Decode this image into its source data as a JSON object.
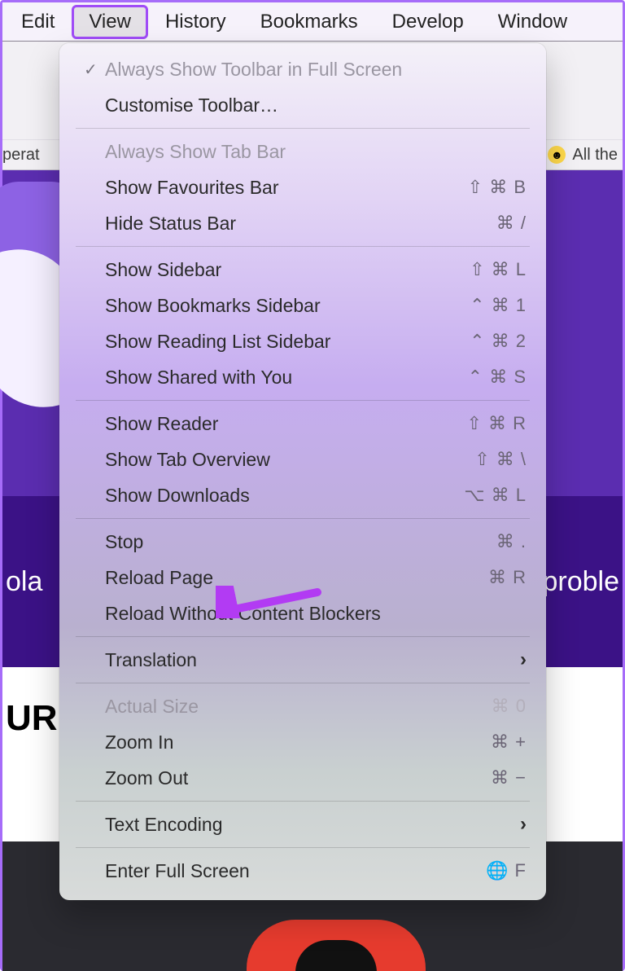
{
  "menubar": {
    "items": [
      "Edit",
      "View",
      "History",
      "Bookmarks",
      "Develop",
      "Window"
    ],
    "highlighted_index": 1
  },
  "bookmarks_bar": {
    "left_fragment": "perat",
    "right_label": "All the"
  },
  "page_fragments": {
    "band_left": "ola",
    "band_right": "proble",
    "headline_fragment": "UR"
  },
  "dropdown": {
    "groups": [
      [
        {
          "label": "Always Show Toolbar in Full Screen",
          "shortcut": "",
          "disabled": true,
          "checked": true,
          "submenu": false
        },
        {
          "label": "Customise Toolbar…",
          "shortcut": "",
          "disabled": false,
          "checked": false,
          "submenu": false
        }
      ],
      [
        {
          "label": "Always Show Tab Bar",
          "shortcut": "",
          "disabled": true,
          "checked": false,
          "submenu": false
        },
        {
          "label": "Show Favourites Bar",
          "shortcut": "⇧ ⌘ B",
          "disabled": false,
          "checked": false,
          "submenu": false
        },
        {
          "label": "Hide Status Bar",
          "shortcut": "⌘ /",
          "disabled": false,
          "checked": false,
          "submenu": false
        }
      ],
      [
        {
          "label": "Show Sidebar",
          "shortcut": "⇧ ⌘ L",
          "disabled": false,
          "checked": false,
          "submenu": false
        },
        {
          "label": "Show Bookmarks Sidebar",
          "shortcut": "⌃ ⌘ 1",
          "disabled": false,
          "checked": false,
          "submenu": false
        },
        {
          "label": "Show Reading List Sidebar",
          "shortcut": "⌃ ⌘ 2",
          "disabled": false,
          "checked": false,
          "submenu": false
        },
        {
          "label": "Show Shared with You",
          "shortcut": "⌃ ⌘ S",
          "disabled": false,
          "checked": false,
          "submenu": false
        }
      ],
      [
        {
          "label": "Show Reader",
          "shortcut": "⇧ ⌘ R",
          "disabled": false,
          "checked": false,
          "submenu": false
        },
        {
          "label": "Show Tab Overview",
          "shortcut": "⇧ ⌘ \\",
          "disabled": false,
          "checked": false,
          "submenu": false
        },
        {
          "label": "Show Downloads",
          "shortcut": "⌥ ⌘ L",
          "disabled": false,
          "checked": false,
          "submenu": false
        }
      ],
      [
        {
          "label": "Stop",
          "shortcut": "⌘ .",
          "disabled": false,
          "checked": false,
          "submenu": false
        },
        {
          "label": "Reload Page",
          "shortcut": "⌘ R",
          "disabled": false,
          "checked": false,
          "submenu": false
        },
        {
          "label": "Reload Without Content Blockers",
          "shortcut": "",
          "disabled": false,
          "checked": false,
          "submenu": false
        }
      ],
      [
        {
          "label": "Translation",
          "shortcut": "",
          "disabled": false,
          "checked": false,
          "submenu": true
        }
      ],
      [
        {
          "label": "Actual Size",
          "shortcut": "⌘ 0",
          "disabled": true,
          "checked": false,
          "submenu": false
        },
        {
          "label": "Zoom In",
          "shortcut": "⌘ +",
          "disabled": false,
          "checked": false,
          "submenu": false
        },
        {
          "label": "Zoom Out",
          "shortcut": "⌘ −",
          "disabled": false,
          "checked": false,
          "submenu": false
        }
      ],
      [
        {
          "label": "Text Encoding",
          "shortcut": "",
          "disabled": false,
          "checked": false,
          "submenu": true
        }
      ],
      [
        {
          "label": "Enter Full Screen",
          "shortcut": "🌐 F",
          "disabled": false,
          "checked": false,
          "submenu": false
        }
      ]
    ]
  },
  "annotation": {
    "arrow_target": "Reload Page",
    "color": "#b23bf3"
  }
}
